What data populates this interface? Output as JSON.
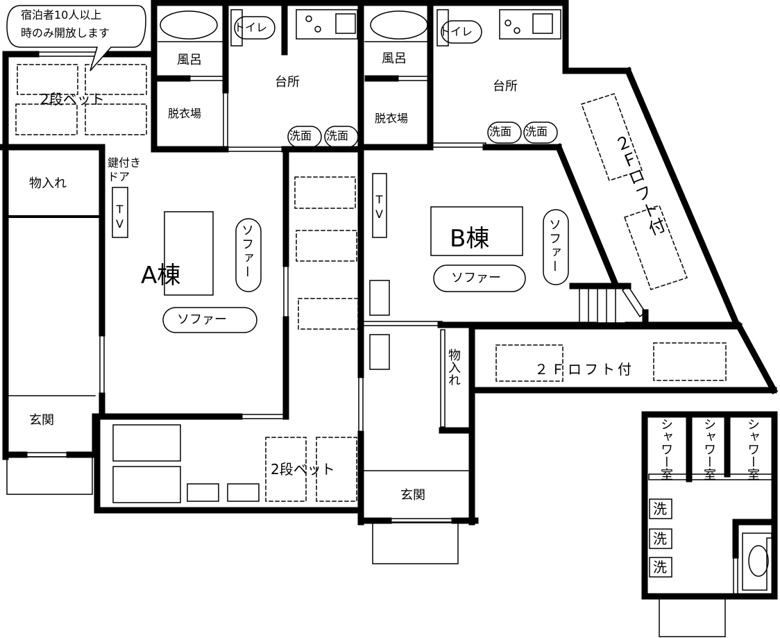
{
  "notice": {
    "line1": "宿泊者10人以上",
    "line2": "時のみ開放します"
  },
  "building_a": {
    "name": "A棟",
    "bunk_upper": "2段ベット",
    "bunk_lower": "2段ベット",
    "storage": "物入れ",
    "entrance": "玄関",
    "locked_door_1": "鍵付き",
    "locked_door_2": "ドア",
    "tv": "TV",
    "sofa_vertical": "ソファー",
    "sofa_horizontal": "ソファー",
    "bath": "風呂",
    "dressing": "脱衣場",
    "toilet": "トイレ",
    "kitchen": "台所",
    "sink1": "洗面",
    "sink2": "洗面"
  },
  "building_b": {
    "name": "B棟",
    "bath": "風呂",
    "dressing": "脱衣場",
    "toilet": "トイレ",
    "kitchen": "台所",
    "sink1": "洗面",
    "sink2": "洗面",
    "tv": "TV",
    "sofa_vertical": "ソファー",
    "sofa_horizontal": "ソファー",
    "loft_upper": "２Ｆロフト付",
    "loft_lower": "２Ｆロフト付",
    "storage": "物入れ",
    "entrance": "玄関"
  },
  "shower_block": {
    "shower1": "シャワー室",
    "shower2": "シャワー室",
    "shower3": "シャワー室",
    "wash1": "洗",
    "wash2": "洗",
    "wash3": "洗"
  }
}
